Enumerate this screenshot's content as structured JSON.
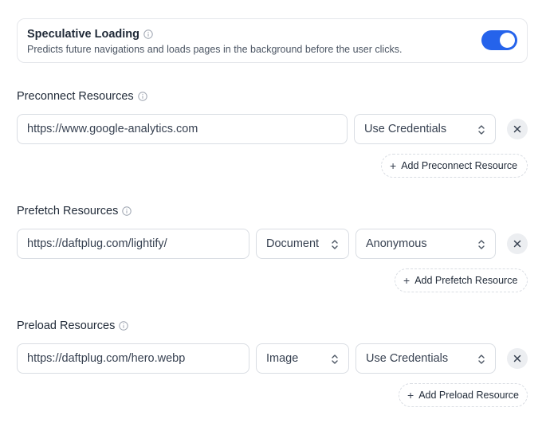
{
  "speculative": {
    "title": "Speculative Loading",
    "description": "Predicts future navigations and loads pages in the background before the user clicks.",
    "enabled": true
  },
  "preconnect": {
    "title": "Preconnect Resources",
    "url": "https://www.google-analytics.com",
    "crossorigin": "Use Credentials",
    "add_label": "Add Preconnect Resource"
  },
  "prefetch": {
    "title": "Prefetch Resources",
    "url": "https://daftplug.com/lightify/",
    "type": "Document",
    "crossorigin": "Anonymous",
    "add_label": "Add Prefetch Resource"
  },
  "preload": {
    "title": "Preload Resources",
    "url": "https://daftplug.com/hero.webp",
    "type": "Image",
    "crossorigin": "Use Credentials",
    "add_label": "Add Preload Resource"
  },
  "colors": {
    "accent": "#2563eb",
    "border": "#d9dde3",
    "text": "#1f2937",
    "muted": "#4b5563"
  }
}
